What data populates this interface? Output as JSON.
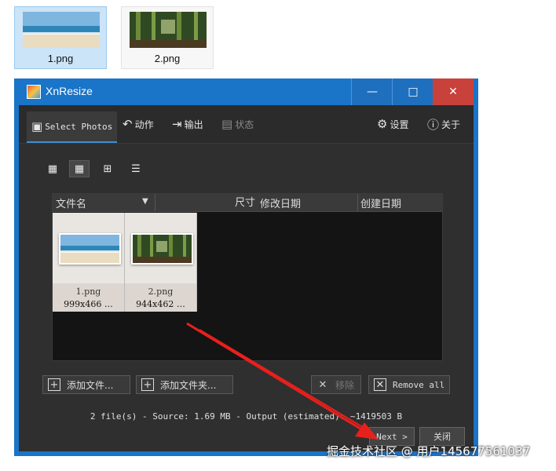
{
  "desktop": {
    "files": [
      {
        "name": "1.png",
        "selected": true
      },
      {
        "name": "2.png",
        "selected": false
      }
    ]
  },
  "window": {
    "title": "XnResize",
    "controls": {
      "minimize": "—",
      "maximize": "□",
      "close": "✕"
    }
  },
  "toolbar": {
    "select_photos": "Select Photos",
    "actions": "动作",
    "output": "输出",
    "status": "状态",
    "settings": "设置",
    "about": "关于"
  },
  "list": {
    "columns": [
      "文件名",
      "尺寸",
      "修改日期",
      "创建日期"
    ],
    "items": [
      {
        "name": "1.png",
        "size": "999x466 …"
      },
      {
        "name": "2.png",
        "size": "944x462 …"
      }
    ]
  },
  "buttons": {
    "add_files": "添加文件...",
    "add_folder": "添加文件夹...",
    "remove": "移除",
    "remove_all": "Remove all"
  },
  "status_line": "2 file(s) - Source: 1.69 MB - Output (estimated): ~1419503 B",
  "nav": {
    "next": "Next >",
    "close": "关闭"
  },
  "watermark": "掘金技术社区 @ 用户145677561037",
  "colors": {
    "title_bar": "#1a74c8",
    "close_button": "#c8413b",
    "panel": "#2f2f2f",
    "arrow": "#e8201c"
  }
}
